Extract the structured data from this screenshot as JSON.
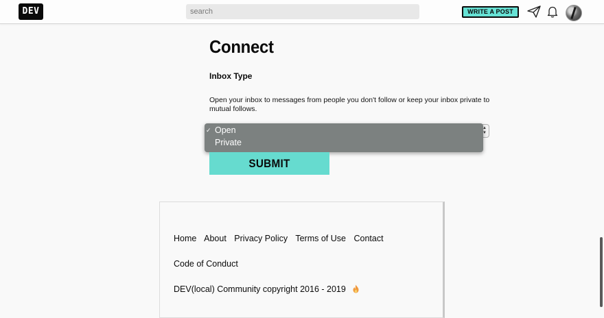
{
  "header": {
    "logo": "DEV",
    "search_placeholder": "search",
    "write_post_label": "WRITE A POST",
    "icons": [
      "send-icon",
      "bell-icon",
      "avatar"
    ]
  },
  "main": {
    "title": "Connect",
    "inbox_label": "Inbox Type",
    "inbox_description": "Open your inbox to messages from people you don't follow or keep your inbox private to mutual follows.",
    "inbox_select": {
      "selected": "Open",
      "options": [
        "Open",
        "Private"
      ],
      "check_mark": "✓"
    },
    "submit_label": "SUBMIT"
  },
  "footer": {
    "links": [
      "Home",
      "About",
      "Privacy Policy",
      "Terms of Use",
      "Contact"
    ],
    "code_of_conduct": "Code of Conduct",
    "copyright": "DEV(local) Community copyright 2016 - 2019"
  },
  "colors": {
    "accent": "#66e2d5",
    "dropdown_bg": "#7c8180",
    "text": "#0a0a0a"
  }
}
